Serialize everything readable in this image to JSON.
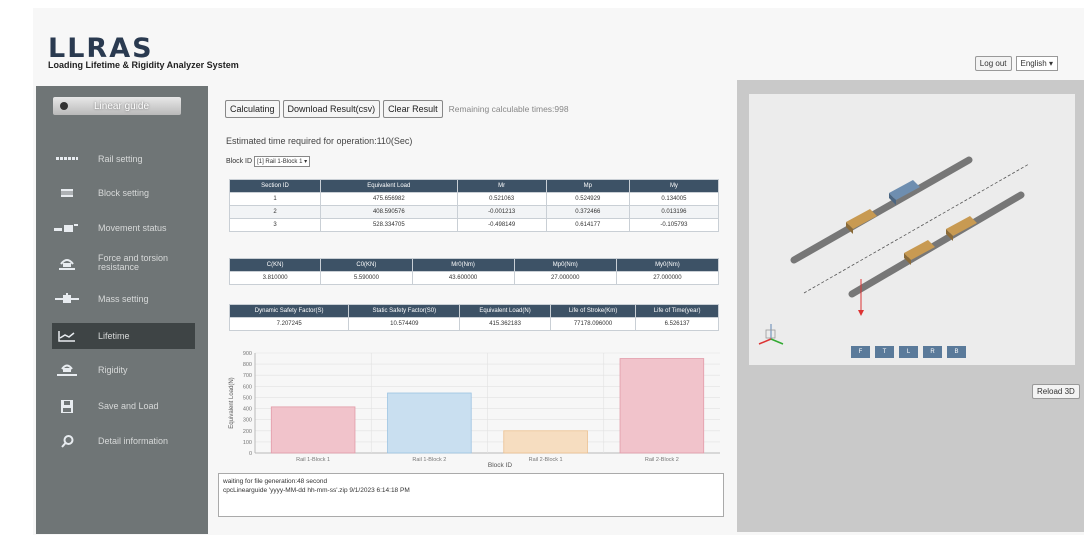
{
  "app": {
    "title": "LLRAS",
    "subtitle": "Loading Lifetime & Rigidity Analyzer System"
  },
  "header": {
    "logout_label": "Log out",
    "language": "English"
  },
  "sidebar": {
    "top_label": "Linear guide",
    "items": [
      {
        "label": "Rail setting",
        "icon": "rail-icon"
      },
      {
        "label": "Block setting",
        "icon": "block-icon"
      },
      {
        "label": "Movement status",
        "icon": "movement-icon"
      },
      {
        "label": "Force and torsion resistance",
        "icon": "force-icon"
      },
      {
        "label": "Mass setting",
        "icon": "mass-icon"
      },
      {
        "label": "Lifetime",
        "icon": "lifetime-icon",
        "active": true
      },
      {
        "label": "Rigidity",
        "icon": "rigidity-icon"
      },
      {
        "label": "Save and Load",
        "icon": "save-icon"
      },
      {
        "label": "Detail information",
        "icon": "search-icon"
      }
    ]
  },
  "toolbar": {
    "calculating_label": "Calculating",
    "download_label": "Download Result(csv)",
    "clear_label": "Clear Result",
    "remaining": "Remaining calculable times:998"
  },
  "estimate": "Estimated time required for operation:110(Sec)",
  "block": {
    "label": "Block ID",
    "selected": "[1] Rail 1-Block 1"
  },
  "table1": {
    "headers": [
      "Section ID",
      "Equivalent Load",
      "Mr",
      "Mp",
      "My"
    ],
    "rows": [
      [
        "1",
        "475.656982",
        "0.521063",
        "0.524929",
        "0.134005"
      ],
      [
        "2",
        "408.590576",
        "-0.001213",
        "0.372466",
        "0.013196"
      ],
      [
        "3",
        "528.334705",
        "-0.498149",
        "0.614177",
        "-0.105793"
      ]
    ]
  },
  "table2": {
    "headers": [
      "C(KN)",
      "C0(KN)",
      "Mr0(Nm)",
      "Mp0(Nm)",
      "My0(Nm)"
    ],
    "rows": [
      [
        "3.810000",
        "5.590000",
        "43.600000",
        "27.000000",
        "27.000000"
      ]
    ]
  },
  "table3": {
    "headers": [
      "Dynamic Safety Factor(S)",
      "Static Safety Factor(S0)",
      "Equivalent Load(N)",
      "Life of Stroke(Km)",
      "Life of Time(year)"
    ],
    "rows": [
      [
        "7.207245",
        "10.574409",
        "415.362183",
        "77178.096000",
        "6.526137"
      ]
    ]
  },
  "chart_data": {
    "type": "bar",
    "categories": [
      "Rail 1-Block 1",
      "Rail 1-Block 2",
      "Rail 2-Block 1",
      "Rail 2-Block 2"
    ],
    "values": [
      415,
      540,
      200,
      850
    ],
    "colors": [
      "#f1c3cb",
      "#c9dff0",
      "#f6ddc0",
      "#f1c3cb"
    ],
    "edge_colors": [
      "#e29aa8",
      "#9cc3e2",
      "#ecc08f",
      "#e29aa8"
    ],
    "xlabel": "Block ID",
    "ylabel": "Equivalent Load(N)",
    "ylim": [
      0,
      900
    ],
    "yticks": [
      "0",
      "100",
      "200",
      "300",
      "400",
      "500",
      "600",
      "700",
      "800",
      "900"
    ],
    "grid": true
  },
  "log": {
    "line1": "waiting for file generation:48 second",
    "line2": "cpcLinearguide 'yyyy-MM-dd hh-mm-ss'.zip  9/1/2023 6:14:18 PM"
  },
  "viewer": {
    "buttons": [
      "F",
      "T",
      "L",
      "R",
      "B"
    ],
    "reload_label": "Reload 3D"
  }
}
